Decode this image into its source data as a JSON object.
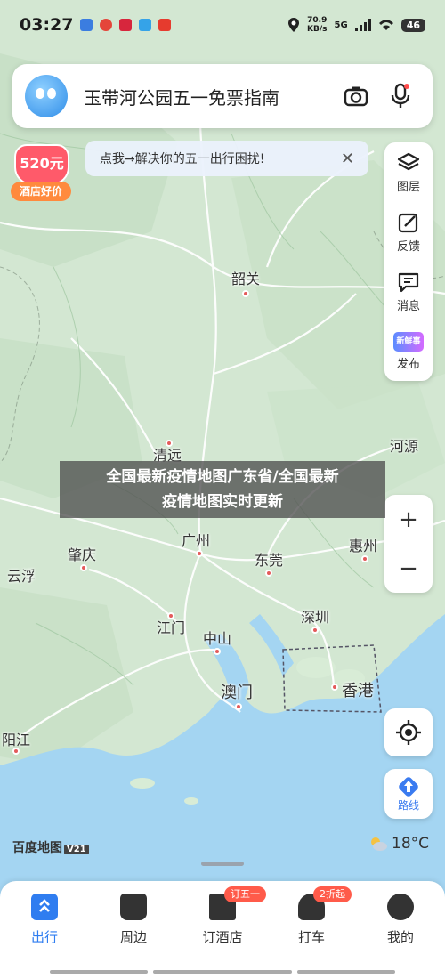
{
  "status_bar": {
    "time": "03:27",
    "speed_value": "70.9",
    "speed_unit": "KB/s",
    "network": "5G",
    "battery": "46"
  },
  "search": {
    "placeholder": "玉带河公园五一免票指南"
  },
  "banner": {
    "text": "点我→解决你的五一出行困扰!",
    "close": "✕"
  },
  "hotel_badge": {
    "amount": "520元",
    "label": "酒店好价"
  },
  "toolbar": [
    {
      "label": "图层",
      "icon": "layers-icon"
    },
    {
      "label": "反馈",
      "icon": "feedback-icon"
    },
    {
      "label": "消息",
      "icon": "message-icon"
    },
    {
      "label": "发布",
      "icon": "publish-icon",
      "badge": "新鲜事"
    }
  ],
  "zoom": {
    "in": "+",
    "out": "−"
  },
  "route_button": {
    "label": "路线"
  },
  "overlay_title": {
    "line1": "全国最新疫情地图广东省/全国最新",
    "line2": "疫情地图实时更新"
  },
  "cities": [
    {
      "name": "韶关"
    },
    {
      "name": "清远"
    },
    {
      "name": "河源"
    },
    {
      "name": "广州"
    },
    {
      "name": "肇庆"
    },
    {
      "name": "东莞"
    },
    {
      "name": "惠州"
    },
    {
      "name": "云浮"
    },
    {
      "name": "江门"
    },
    {
      "name": "中山"
    },
    {
      "name": "深圳"
    },
    {
      "name": "澳门"
    },
    {
      "name": "香港"
    },
    {
      "name": "阳江"
    }
  ],
  "map_brand": {
    "name": "百度地图",
    "version": "V21"
  },
  "weather": {
    "temp": "18°C",
    "icon": "partly-cloudy-icon"
  },
  "tabs": [
    {
      "label": "出行",
      "active": true,
      "icon": "travel-icon"
    },
    {
      "label": "周边",
      "active": false,
      "icon": "nearby-icon"
    },
    {
      "label": "订酒店",
      "active": false,
      "icon": "hotel-icon",
      "tag": "订五一"
    },
    {
      "label": "打车",
      "active": false,
      "icon": "taxi-icon",
      "tag": "2折起"
    },
    {
      "label": "我的",
      "active": false,
      "icon": "profile-icon"
    }
  ],
  "colors": {
    "accent": "#2f7df0",
    "land": "#d6e9d6",
    "sea": "#9fd3f2",
    "road": "#ffffff",
    "tag": "#ff5b4a"
  }
}
